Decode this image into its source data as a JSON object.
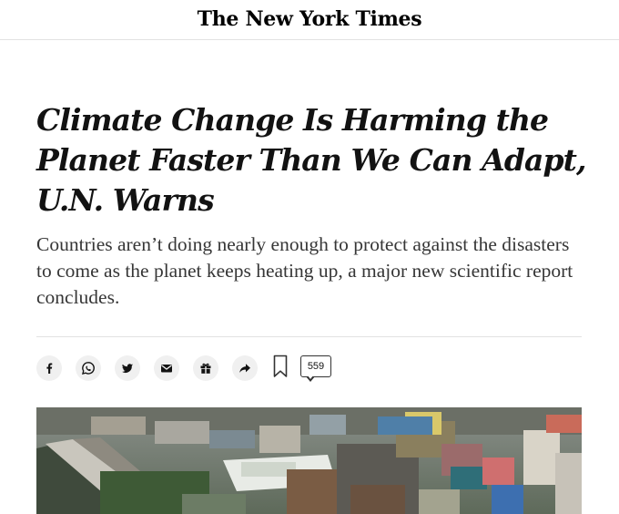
{
  "masthead": {
    "logo": "The New York Times"
  },
  "article": {
    "headline": "Climate Change Is Harming the Planet Faster Than We Can Adapt, U.N. Warns",
    "summary": "Countries aren’t doing nearly enough to protect against the disasters to come as the planet keeps heating up, a major new scientific report concludes."
  },
  "share": {
    "icons": [
      "facebook-icon",
      "whatsapp-icon",
      "twitter-icon",
      "email-icon",
      "gift-icon",
      "share-icon",
      "bookmark-icon"
    ],
    "comment_count": "559"
  }
}
